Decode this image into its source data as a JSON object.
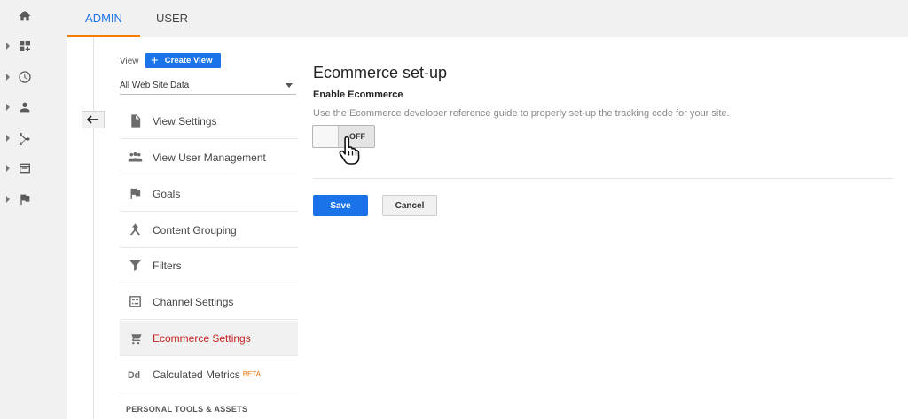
{
  "rail": {
    "items": [
      {
        "icon": "home-icon"
      },
      {
        "icon": "dashboard-customization-icon"
      },
      {
        "icon": "clock-icon"
      },
      {
        "icon": "person-icon"
      },
      {
        "icon": "acquisition-icon"
      },
      {
        "icon": "browser-window-icon"
      },
      {
        "icon": "flag-icon"
      }
    ]
  },
  "tabs": [
    {
      "label": "ADMIN",
      "active": true
    },
    {
      "label": "USER",
      "active": false
    }
  ],
  "nav": {
    "view_label": "View",
    "create_view_label": "Create View",
    "selected_view": "All Web Site Data",
    "items": [
      {
        "label": "View Settings",
        "icon": "document-icon"
      },
      {
        "label": "View User Management",
        "icon": "people-icon"
      },
      {
        "label": "Goals",
        "icon": "flag-icon"
      },
      {
        "label": "Content Grouping",
        "icon": "content-grouping-icon"
      },
      {
        "label": "Filters",
        "icon": "filter-icon"
      },
      {
        "label": "Channel Settings",
        "icon": "channel-settings-icon"
      },
      {
        "label": "Ecommerce Settings",
        "icon": "cart-icon",
        "active": true
      },
      {
        "label": "Calculated Metrics",
        "icon": "dd-icon",
        "badge": "BETA"
      }
    ],
    "section_title": "PERSONAL TOOLS & ASSETS"
  },
  "main": {
    "title": "Ecommerce set-up",
    "subhead": "Enable Ecommerce",
    "description": "Use the Ecommerce developer reference guide to properly set-up the tracking code for your site.",
    "toggle_state": "OFF",
    "save_label": "Save",
    "cancel_label": "Cancel"
  },
  "colors": {
    "accent_blue": "#1a73e8",
    "active_red": "#c5221f",
    "tab_underline": "#f57c00",
    "beta_orange": "#e8710a"
  }
}
